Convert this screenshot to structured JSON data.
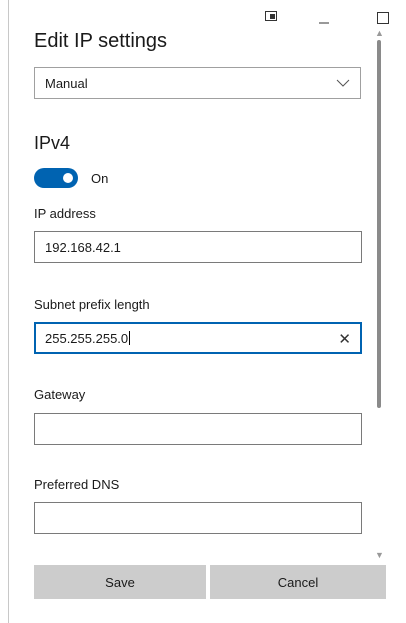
{
  "dialog": {
    "title": "Edit IP settings",
    "mode_select": {
      "value": "Manual"
    },
    "section_title": "IPv4",
    "toggle": {
      "state": "On",
      "checked": true
    },
    "fields": {
      "ip_address": {
        "label": "IP address",
        "value": "192.168.42.1"
      },
      "subnet": {
        "label": "Subnet prefix length",
        "value": "255.255.255.0"
      },
      "gateway": {
        "label": "Gateway",
        "value": ""
      },
      "preferred_dns": {
        "label": "Preferred DNS",
        "value": ""
      }
    },
    "buttons": {
      "save": "Save",
      "cancel": "Cancel"
    }
  },
  "colors": {
    "accent": "#0063b1",
    "button_bg": "#cccccc"
  },
  "icons": {
    "snap": "snap-layout-icon",
    "minimize": "minimize-icon",
    "maximize": "maximize-icon",
    "chevron": "chevron-down-icon",
    "clear": "close-icon"
  }
}
